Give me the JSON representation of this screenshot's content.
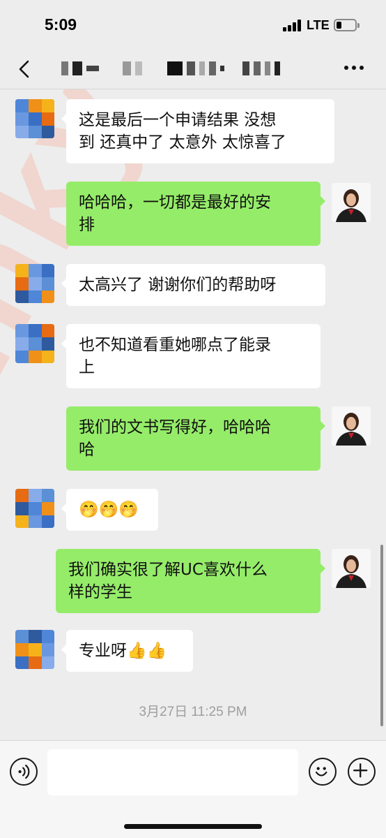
{
  "status_bar": {
    "time": "5:09",
    "network": "LTE"
  },
  "nav": {
    "title": "",
    "back_icon": "chevron-left-icon",
    "more_icon": "more-dots-icon"
  },
  "messages": [
    {
      "side": "other",
      "lines": [
        "这是最后一个申请结果 没想",
        "到 还真中了 太意外 太惊喜了"
      ]
    },
    {
      "side": "me",
      "lines": [
        "哈哈哈，一切都是最好的安",
        "排"
      ]
    },
    {
      "side": "other",
      "lines": [
        "太高兴了 谢谢你们的帮助呀"
      ]
    },
    {
      "side": "other",
      "lines": [
        "也不知道看重她哪点了能录",
        "上"
      ]
    },
    {
      "side": "me",
      "lines": [
        "我们的文书写得好，哈哈哈",
        "哈"
      ]
    },
    {
      "side": "other",
      "lines": [
        "🤭🤭🤭"
      ]
    },
    {
      "side": "me",
      "lines": [
        "我们确实很了解UC喜欢什么",
        "样的学生"
      ]
    },
    {
      "side": "other",
      "lines": [
        "专业呀👍👍"
      ]
    }
  ],
  "timestamp": "3月27日 11:25 PM",
  "watermark": "Tinky",
  "input": {
    "placeholder": "",
    "voice_icon": "voice-icon",
    "emoji_icon": "emoji-icon",
    "plus_icon": "plus-icon"
  },
  "colors": {
    "background": "#ededed",
    "my_bubble": "#95ec69",
    "other_bubble": "#ffffff",
    "timestamp": "#9e9e9e"
  }
}
